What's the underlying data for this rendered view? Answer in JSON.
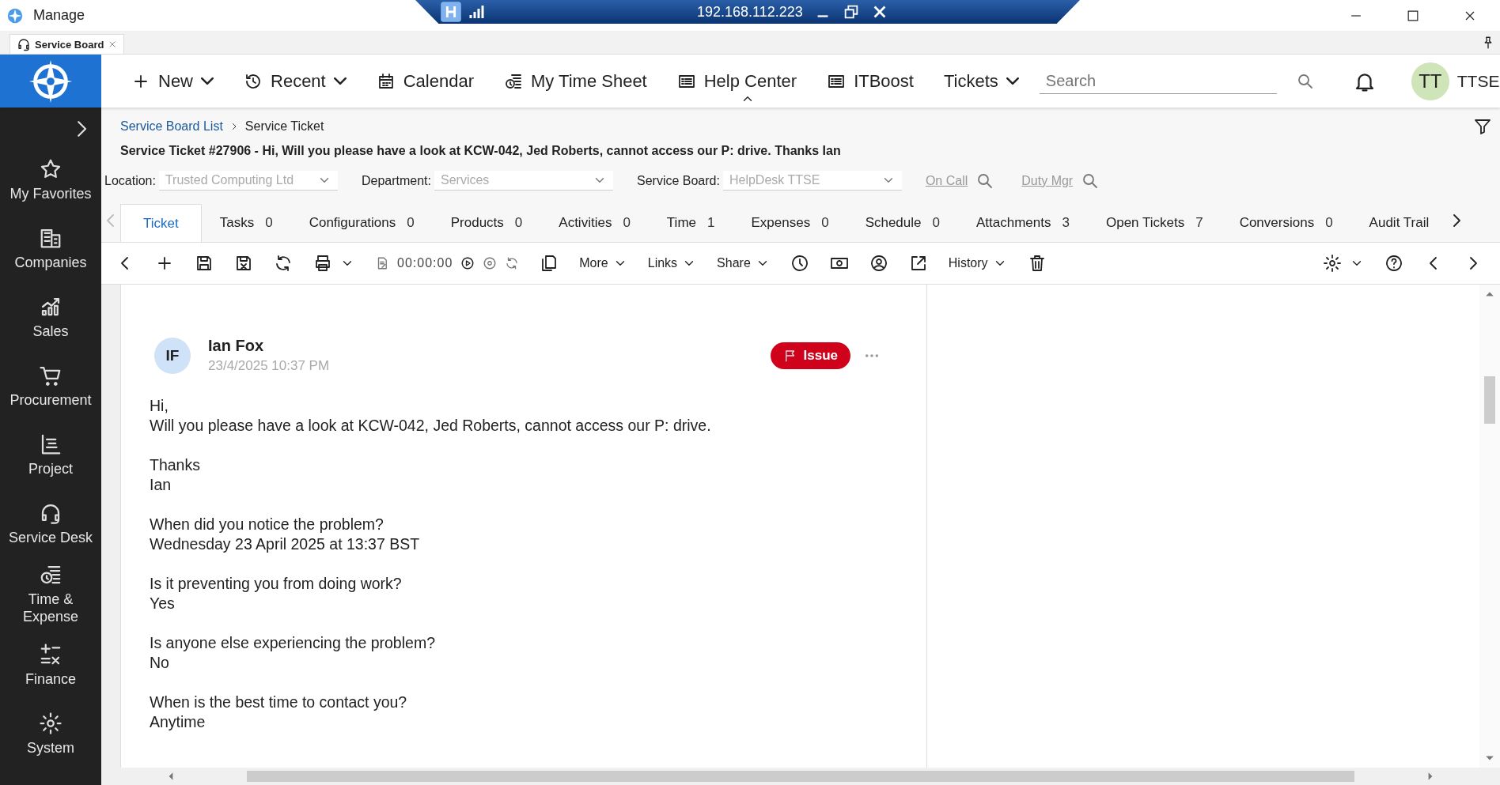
{
  "window": {
    "title": "Manage"
  },
  "remote_bar": {
    "address": "192.168.112.223"
  },
  "app_tab": {
    "label": "Service Board"
  },
  "nav": {
    "items": [
      {
        "label": "New",
        "has_menu": true
      },
      {
        "label": "Recent",
        "has_menu": true
      },
      {
        "label": "Calendar",
        "has_menu": false
      },
      {
        "label": "My Time Sheet",
        "has_menu": false
      },
      {
        "label": "Help Center",
        "has_menu": false
      },
      {
        "label": "ITBoost",
        "has_menu": false
      },
      {
        "label": "Tickets",
        "has_menu": true
      }
    ],
    "search": {
      "placeholder": "Search"
    },
    "user": {
      "initials": "TT",
      "name": "TTSE"
    }
  },
  "sidebar": {
    "items": [
      "My Favorites",
      "Companies",
      "Sales",
      "Procurement",
      "Project",
      "Service Desk",
      "Time & Expense",
      "Finance",
      "System"
    ]
  },
  "breadcrumb": [
    "Service Board List",
    "Service Ticket"
  ],
  "ticket_title": "Service Ticket #27906 - Hi, Will you please have a look at KCW-042, Jed Roberts, cannot access our P: drive. Thanks Ian",
  "filters": [
    {
      "label": "Location:",
      "value": "Trusted Computing Ltd"
    },
    {
      "label": "Department:",
      "value": "Services"
    },
    {
      "label": "Service Board:",
      "value": "HelpDesk TTSE"
    }
  ],
  "lookup_links": [
    "On Call",
    "Duty Mgr"
  ],
  "tabs": [
    {
      "label": "Ticket",
      "selected": true
    },
    {
      "label": "Tasks",
      "count": "0",
      "selected": false
    },
    {
      "label": "Configurations",
      "count": "0",
      "selected": false
    },
    {
      "label": "Products",
      "count": "0",
      "selected": false
    },
    {
      "label": "Activities",
      "count": "0",
      "selected": false
    },
    {
      "label": "Time",
      "count": "1",
      "selected": false
    },
    {
      "label": "Expenses",
      "count": "0",
      "selected": false
    },
    {
      "label": "Schedule",
      "count": "0",
      "selected": false
    },
    {
      "label": "Attachments",
      "count": "3",
      "selected": false
    },
    {
      "label": "Open Tickets",
      "count": "7",
      "selected": false
    },
    {
      "label": "Conversions",
      "count": "0",
      "selected": false
    },
    {
      "label": "Audit Trail",
      "selected": false
    }
  ],
  "toolbar": {
    "timer": "00:00:00",
    "menus": [
      "More",
      "Links",
      "Share",
      "History"
    ]
  },
  "message": {
    "initials": "IF",
    "author": "Ian Fox",
    "date": "23/4/2025 10:37 PM",
    "tag": "Issue",
    "paragraphs": [
      "Hi,\nWill you please have a look at KCW-042, Jed Roberts, cannot access our P: drive.",
      "Thanks\nIan",
      "When did you notice the problem?\nWednesday 23 April 2025 at 13:37 BST",
      "Is it preventing you from doing work?\nYes",
      "Is anyone else experiencing the problem?\nNo",
      "When is the best time to contact you?\nAnytime"
    ]
  }
}
